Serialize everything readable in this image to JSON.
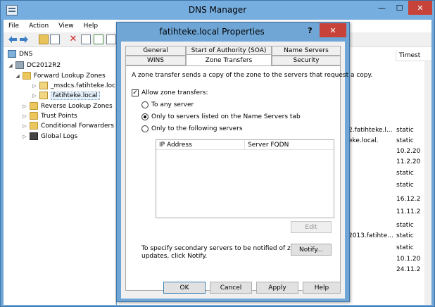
{
  "window": {
    "title": "DNS Manager",
    "min_glyph": "—",
    "max_glyph": "☐",
    "close_glyph": "✕"
  },
  "menu": [
    "File",
    "Action",
    "View",
    "Help"
  ],
  "toolbar": {
    "icons": [
      "back-arrow-icon",
      "forward-arrow-icon",
      "up-folder-icon",
      "properties-icon",
      "delete-icon",
      "refresh-icon",
      "export-icon",
      "help-icon",
      "view-icon"
    ],
    "delete_glyph": "✕"
  },
  "tree": [
    {
      "label": "DNS",
      "level": 0,
      "toggle": "",
      "icon": "dns"
    },
    {
      "label": "DC2012R2",
      "level": 1,
      "toggle": "◢",
      "icon": "server"
    },
    {
      "label": "Forward Lookup Zones",
      "level": 2,
      "toggle": "◢",
      "icon": "folder"
    },
    {
      "label": "_msdcs.fatihteke.loca",
      "level": 3,
      "toggle": "▷",
      "icon": "zone"
    },
    {
      "label": "fatihteke.local",
      "level": 3,
      "toggle": "▷",
      "icon": "zone",
      "selected": true
    },
    {
      "label": "Reverse Lookup Zones",
      "level": 2,
      "toggle": "▷",
      "icon": "folder"
    },
    {
      "label": "Trust Points",
      "level": 2,
      "toggle": "▷",
      "icon": "folder"
    },
    {
      "label": "Conditional Forwarders",
      "level": 2,
      "toggle": "▷",
      "icon": "folder"
    },
    {
      "label": "Global Logs",
      "level": 2,
      "toggle": "▷",
      "icon": "log"
    }
  ],
  "list": {
    "column_header": "Timest",
    "fragments": [
      {
        "text": "2.fatihteke.l..."
      },
      {
        "text": "static"
      },
      {
        "text": "eke.local."
      },
      {
        "text": "static"
      },
      {
        "text": "10.2.20"
      },
      {
        "text": "11.2.20"
      },
      {
        "text": "static"
      },
      {
        "text": "static"
      },
      {
        "text": "16.12.2"
      },
      {
        "text": "11.11.2"
      },
      {
        "text": "static"
      },
      {
        "text": "2013.fatihte..."
      },
      {
        "text": "static"
      },
      {
        "text": "static"
      },
      {
        "text": "10.1.20"
      },
      {
        "text": "24.11.2"
      }
    ]
  },
  "dialog": {
    "title": "fatihteke.local Properties",
    "help_glyph": "?",
    "close_glyph": "✕",
    "tabs_row1": [
      "General",
      "Start of Authority (SOA)",
      "Name Servers"
    ],
    "tabs_row2": [
      "WINS",
      "Zone Transfers",
      "Security"
    ],
    "active_tab": "Zone Transfers",
    "description": "A zone transfer sends a copy of the zone to the servers that request a copy.",
    "allow_checkbox": {
      "label": "Allow zone transfers:",
      "checked": true,
      "mark": "✓"
    },
    "radios": [
      {
        "label": "To any server",
        "selected": false
      },
      {
        "label": "Only to servers listed on the Name Servers tab",
        "selected": true
      },
      {
        "label": "Only to the following servers",
        "selected": false
      }
    ],
    "table_headers": [
      "IP Address",
      "Server FQDN"
    ],
    "edit_button": "Edit",
    "notify_text_line1": "To specify secondary servers to be notified of zone",
    "notify_text_line2": "updates, click Notify.",
    "notify_button": "Notify...",
    "buttons": {
      "ok": "OK",
      "cancel": "Cancel",
      "apply": "Apply",
      "help": "Help"
    }
  }
}
